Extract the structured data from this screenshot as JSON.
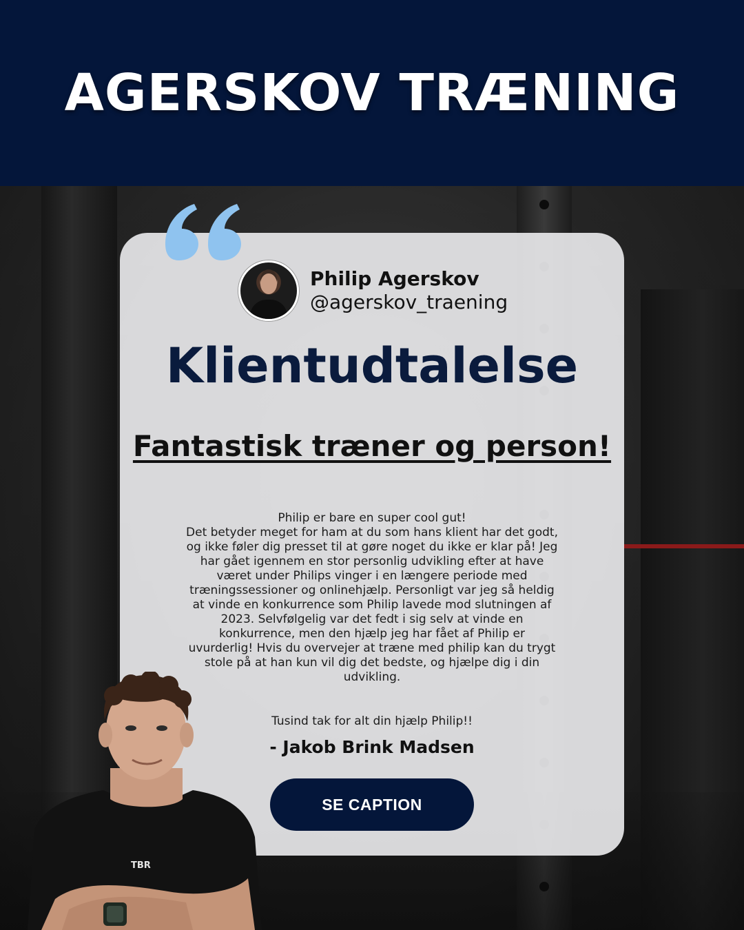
{
  "header": {
    "title": "AGERSKOV TRÆNING"
  },
  "profile": {
    "name": "Philip Agerskov",
    "handle": "@agerskov_traening"
  },
  "card": {
    "title": "Klientudtalelse",
    "subtitle": "Fantastisk træner og person!",
    "body": "Philip er bare en super cool gut!\nDet betyder meget for ham at du som hans klient har det godt, og ikke føler dig presset til at gøre noget du ikke er klar på! Jeg har gået igennem en stor personlig udvikling efter at have været under Philips vinger i en længere periode med træningssessioner og onlinehjælp. Personligt var jeg så heldig at vinde en konkurrence som Philip lavede mod slutningen af 2023. Selvfølgelig var det fedt i sig selv at vinde en konkurrence, men den hjælp jeg har fået af Philip er uvurderlig! Hvis du overvejer at træne med philip kan du trygt stole på at han kun vil dig det bedste, og hjælpe dig i din udvikling.",
    "thanks": "Tusind tak for alt din hjælp Philip!!",
    "signature": "- Jakob Brink Madsen",
    "button_label": "SE CAPTION"
  },
  "colors": {
    "navy": "#04163a",
    "quote_blue": "#8fc3ef",
    "card_bg": "#e8e8ea"
  },
  "icons": {
    "quote": "quote-icon"
  }
}
